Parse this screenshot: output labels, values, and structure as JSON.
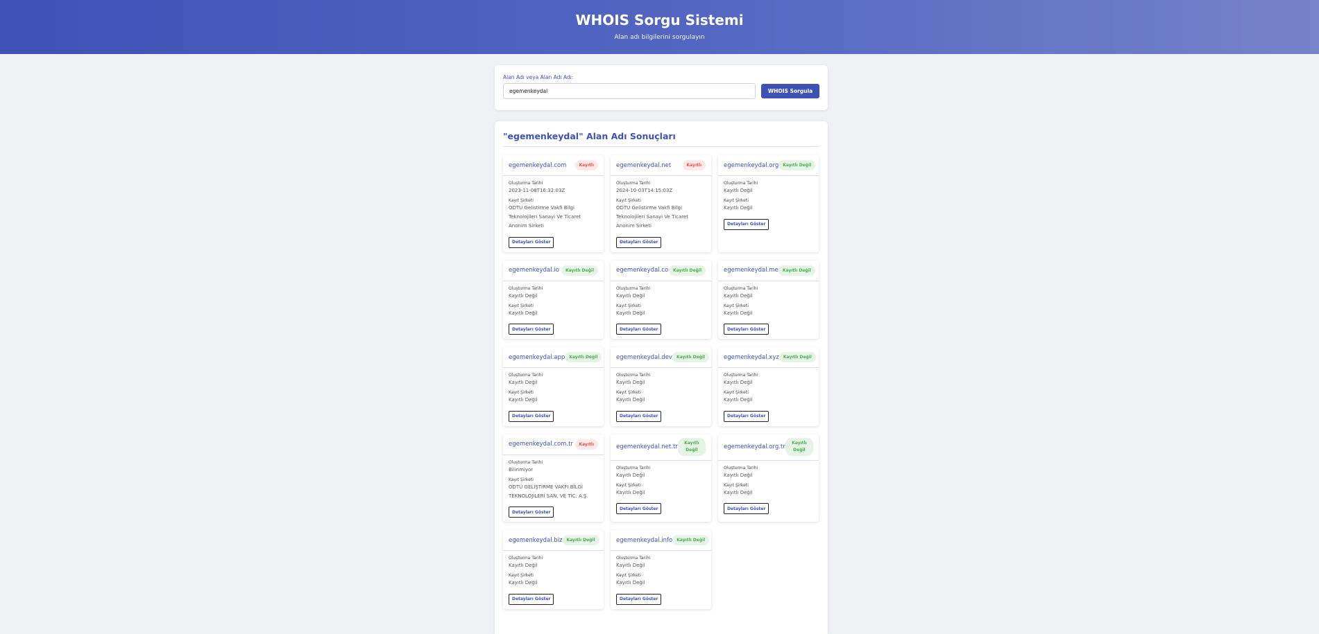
{
  "header": {
    "title": "WHOIS Sorgu Sistemi",
    "subtitle": "Alan adı bilgilerini sorgulayın"
  },
  "search": {
    "label": "Alan Adı veya Alan Adı Adı:",
    "value": "egemenkeydal",
    "button": "WHOIS Sorgula"
  },
  "results": {
    "title": "\"egemenkeydal\" Alan Adı Sonuçları",
    "created_label": "Oluşturma Tarihi",
    "registrar_label": "Kayıt Şirketi",
    "details_button": "Detayları Göster",
    "cards": [
      {
        "domain": "egemenkeydal.com",
        "status": "Kayıtlı",
        "registered": true,
        "created": "2023-11-08T16:32:03Z",
        "registrar": "ODTU Gelistirme Vakfi Bilgi Teknolojileri Sanayi Ve Ticaret Anonim Sirketi"
      },
      {
        "domain": "egemenkeydal.net",
        "status": "Kayıtlı",
        "registered": true,
        "created": "2024-10-03T14:15:03Z",
        "registrar": "ODTU Gelistirme Vakfi Bilgi Teknolojileri Sanayi Ve Ticaret Anonim Sirketi"
      },
      {
        "domain": "egemenkeydal.org",
        "status": "Kayıtlı Değil",
        "registered": false,
        "created": "Kayıtlı Değil",
        "registrar": "Kayıtlı Değil"
      },
      {
        "domain": "egemenkeydal.io",
        "status": "Kayıtlı Değil",
        "registered": false,
        "created": "Kayıtlı Değil",
        "registrar": "Kayıtlı Değil"
      },
      {
        "domain": "egemenkeydal.co",
        "status": "Kayıtlı Değil",
        "registered": false,
        "created": "Kayıtlı Değil",
        "registrar": "Kayıtlı Değil"
      },
      {
        "domain": "egemenkeydal.me",
        "status": "Kayıtlı Değil",
        "registered": false,
        "created": "Kayıtlı Değil",
        "registrar": "Kayıtlı Değil"
      },
      {
        "domain": "egemenkeydal.app",
        "status": "Kayıtlı Değil",
        "registered": false,
        "created": "Kayıtlı Değil",
        "registrar": "Kayıtlı Değil"
      },
      {
        "domain": "egemenkeydal.dev",
        "status": "Kayıtlı Değil",
        "registered": false,
        "created": "Kayıtlı Değil",
        "registrar": "Kayıtlı Değil"
      },
      {
        "domain": "egemenkeydal.xyz",
        "status": "Kayıtlı Değil",
        "registered": false,
        "created": "Kayıtlı Değil",
        "registrar": "Kayıtlı Değil"
      },
      {
        "domain": "egemenkeydal.com.tr",
        "status": "Kayıtlı",
        "registered": true,
        "created": "Bilinmiyor",
        "registrar": "ODTÜ GELİŞTİRME VAKFI BİLGİ TEKNOLOJİLERİ SAN. VE TİC. A.Ş."
      },
      {
        "domain": "egemenkeydal.net.tr",
        "status": "Kayıtlı Değil",
        "registered": false,
        "created": "Kayıtlı Değil",
        "registrar": "Kayıtlı Değil"
      },
      {
        "domain": "egemenkeydal.org.tr",
        "status": "Kayıtlı Değil",
        "registered": false,
        "created": "Kayıtlı Değil",
        "registrar": "Kayıtlı Değil"
      },
      {
        "domain": "egemenkeydal.biz",
        "status": "Kayıtlı Değil",
        "registered": false,
        "created": "Kayıtlı Değil",
        "registrar": "Kayıtlı Değil"
      },
      {
        "domain": "egemenkeydal.info",
        "status": "Kayıtlı Değil",
        "registered": false,
        "created": "Kayıtlı Değil",
        "registrar": "Kayıtlı Değil"
      }
    ]
  },
  "colors": {
    "accent": "#3f51b5",
    "registered_badge_bg": "#fde8e8",
    "registered_badge_text": "#d9534f",
    "free_badge_bg": "#e6f4e6",
    "free_badge_text": "#4caf50"
  }
}
